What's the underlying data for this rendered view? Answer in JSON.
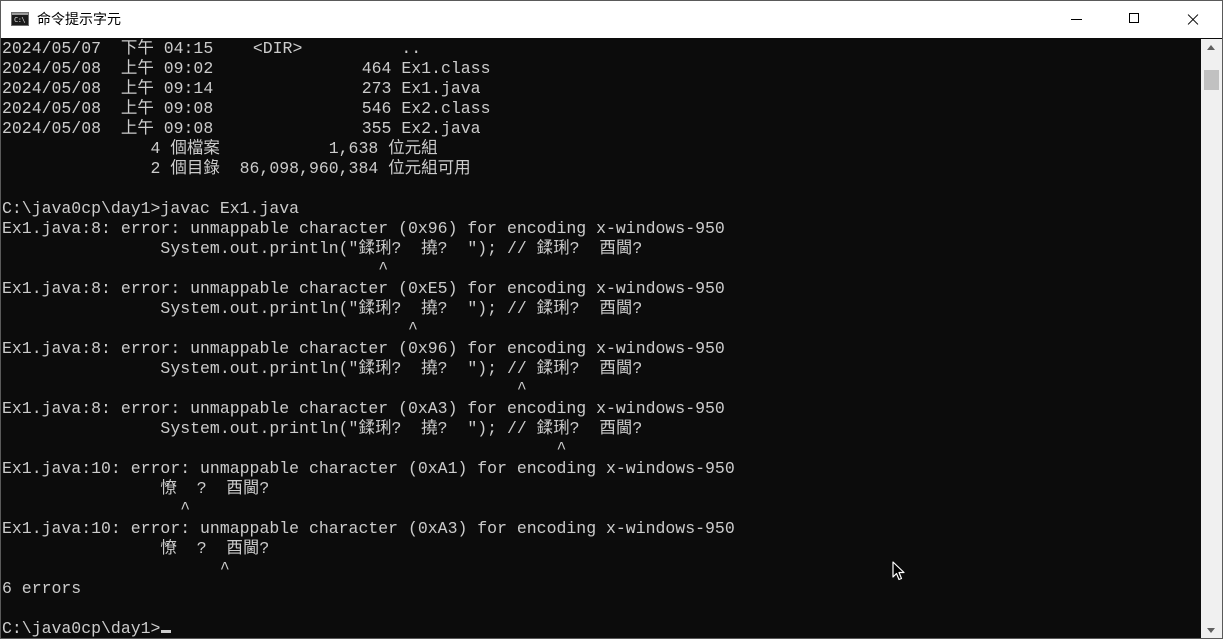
{
  "window": {
    "title": "命令提示字元",
    "icon_text": "C:\\"
  },
  "controls": {
    "minimize": "minimize-icon",
    "maximize": "maximize-icon",
    "close": "close-icon"
  },
  "console": {
    "lines": [
      "2024/05/07  下午 04:15    <DIR>          ..",
      "2024/05/08  上午 09:02               464 Ex1.class",
      "2024/05/08  上午 09:14               273 Ex1.java",
      "2024/05/08  上午 09:08               546 Ex2.class",
      "2024/05/08  上午 09:08               355 Ex2.java",
      "               4 個檔案           1,638 位元組",
      "               2 個目錄  86,098,960,384 位元組可用",
      "",
      "C:\\java0cp\\day1>javac Ex1.java",
      "Ex1.java:8: error: unmappable character (0x96) for encoding x-windows-950",
      "                System.out.println(\"鍒琍?  撓?  \"); // 鍒琍?  酉閫?",
      "                                      ^",
      "Ex1.java:8: error: unmappable character (0xE5) for encoding x-windows-950",
      "                System.out.println(\"鍒琍?  撓?  \"); // 鍒琍?  酉閫?",
      "                                         ^",
      "Ex1.java:8: error: unmappable character (0x96) for encoding x-windows-950",
      "                System.out.println(\"鍒琍?  撓?  \"); // 鍒琍?  酉閫?",
      "                                                    ^",
      "Ex1.java:8: error: unmappable character (0xA3) for encoding x-windows-950",
      "                System.out.println(\"鍒琍?  撓?  \"); // 鍒琍?  酉閫?",
      "                                                        ^",
      "Ex1.java:10: error: unmappable character (0xA1) for encoding x-windows-950",
      "                憭  ?  酉閫?",
      "                  ^",
      "Ex1.java:10: error: unmappable character (0xA3) for encoding x-windows-950",
      "                憭  ?  酉閫?",
      "                      ^",
      "6 errors",
      ""
    ],
    "prompt": "C:\\java0cp\\day1>"
  },
  "scrollbar": {
    "up": "chevron-up-icon",
    "down": "chevron-down-icon"
  },
  "pointer": "mouse-pointer-icon"
}
